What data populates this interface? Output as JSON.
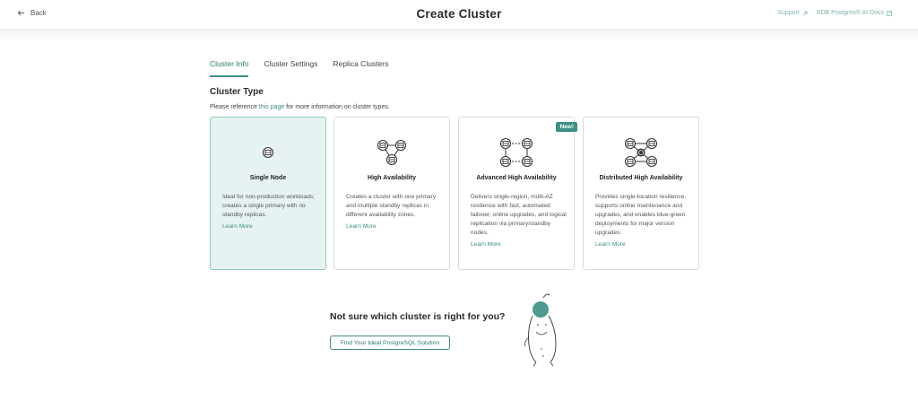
{
  "header": {
    "back_label": "Back",
    "title": "Create Cluster",
    "links": [
      {
        "label": "Support"
      },
      {
        "label": "EDB Postgres® AI Docs"
      }
    ]
  },
  "tabs": [
    {
      "label": "Cluster Info",
      "active": true
    },
    {
      "label": "Cluster Settings",
      "active": false
    },
    {
      "label": "Replica Clusters",
      "active": false
    }
  ],
  "section": {
    "title": "Cluster Type",
    "ref_prefix": "Please reference ",
    "ref_link": "this page",
    "ref_suffix": " for more information on cluster types."
  },
  "cards": [
    {
      "title": "Single Node",
      "icon": "single-node-icon",
      "selected": true,
      "description": "Ideal for non-production workloads; creates a single primary with no standby replicas.",
      "learn_more": "Learn More"
    },
    {
      "title": "High Availability",
      "icon": "high-availability-icon",
      "selected": false,
      "description": "Creates a cluster with one primary and multiple standby replicas in different availability zones.",
      "learn_more": "Learn More"
    },
    {
      "title": "Advanced High Availability",
      "icon": "advanced-high-availability-icon",
      "selected": false,
      "badge": "New!",
      "description": "Delivers single-region, multi-AZ resilience with fast, automated failover, online upgrades, and logical replication via primary/standby nodes.",
      "learn_more": "Learn More"
    },
    {
      "title": "Distributed High Availability",
      "icon": "distributed-high-availability-icon",
      "selected": false,
      "description": "Provides single-location resilience, supports online maintenance and upgrades, and enables blue-green deployments for major version upgrades.",
      "learn_more": "Learn More"
    }
  ],
  "help": {
    "prompt": "Not sure which cluster is right for you?",
    "button": "Find Your Ideal PostgreSQL Solution"
  },
  "colors": {
    "accent": "#3d8e85",
    "selected_bg": "#e6f3f2",
    "link": "#7cb4ad"
  }
}
